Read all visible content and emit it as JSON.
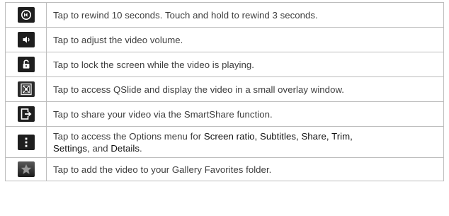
{
  "rows": [
    {
      "icon": "rewind-icon",
      "text": "Tap to rewind 10 seconds. Touch and hold to rewind 3 seconds."
    },
    {
      "icon": "volume-icon",
      "text": "Tap to adjust the video volume."
    },
    {
      "icon": "lock-icon",
      "text": "Tap to lock the screen while the video is playing."
    },
    {
      "icon": "qslide-icon",
      "text": "Tap to access QSlide and display the video in a small overlay window."
    },
    {
      "icon": "share-icon",
      "text": "Tap to share your video via the SmartShare function."
    },
    {
      "icon": "options-menu-icon",
      "text_before": "Tap to access the Options menu for ",
      "bold_1": "Screen ratio, Subtitles, Share, Trim,",
      "bold_2": "Settings",
      "text_mid": ", and ",
      "bold_3": "Details",
      "text_after": "."
    },
    {
      "icon": "star-icon",
      "text": "Tap to add the video to your Gallery Favorites folder."
    }
  ]
}
